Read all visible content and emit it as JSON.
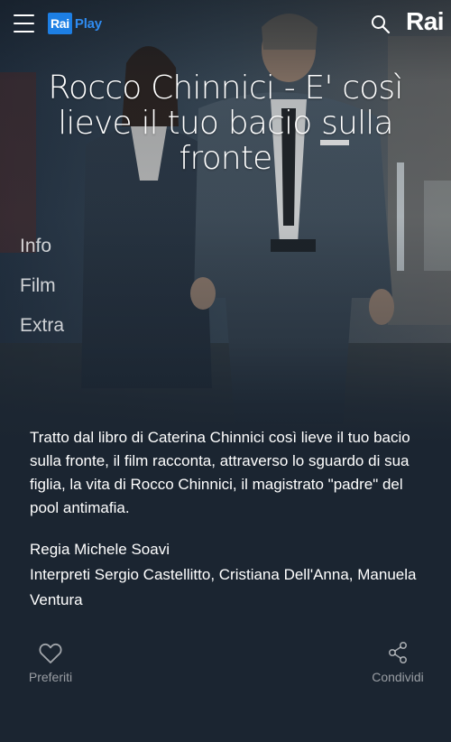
{
  "header": {
    "brand_rai": "Rai",
    "brand_play": "Play",
    "rai_logo": "Rai",
    "menu_icon": "hamburger-menu-icon",
    "search_icon": "search-icon"
  },
  "program": {
    "title": "Rocco Chinnici - E' così lieve il tuo bacio sulla fronte",
    "description": "Tratto dal libro di Caterina Chinnici così lieve il tuo bacio sulla fronte, il film racconta, attraverso lo sguardo di sua figlia, la vita di Rocco Chinnici, il magistrato \"padre\" del pool antimafia.",
    "director": "Regia Michele Soavi",
    "cast": "Interpreti Sergio Castellitto, Cristiana Dell'Anna, Manuela Ventura"
  },
  "sections": [
    {
      "label": "Info"
    },
    {
      "label": "Film"
    },
    {
      "label": "Extra"
    }
  ],
  "actions": {
    "favorites": {
      "label": "Preferiti",
      "icon": "heart-icon"
    },
    "share": {
      "label": "Condividi",
      "icon": "share-icon"
    }
  },
  "colors": {
    "background": "#1b2531",
    "brand_blue": "#1d7fe4"
  }
}
